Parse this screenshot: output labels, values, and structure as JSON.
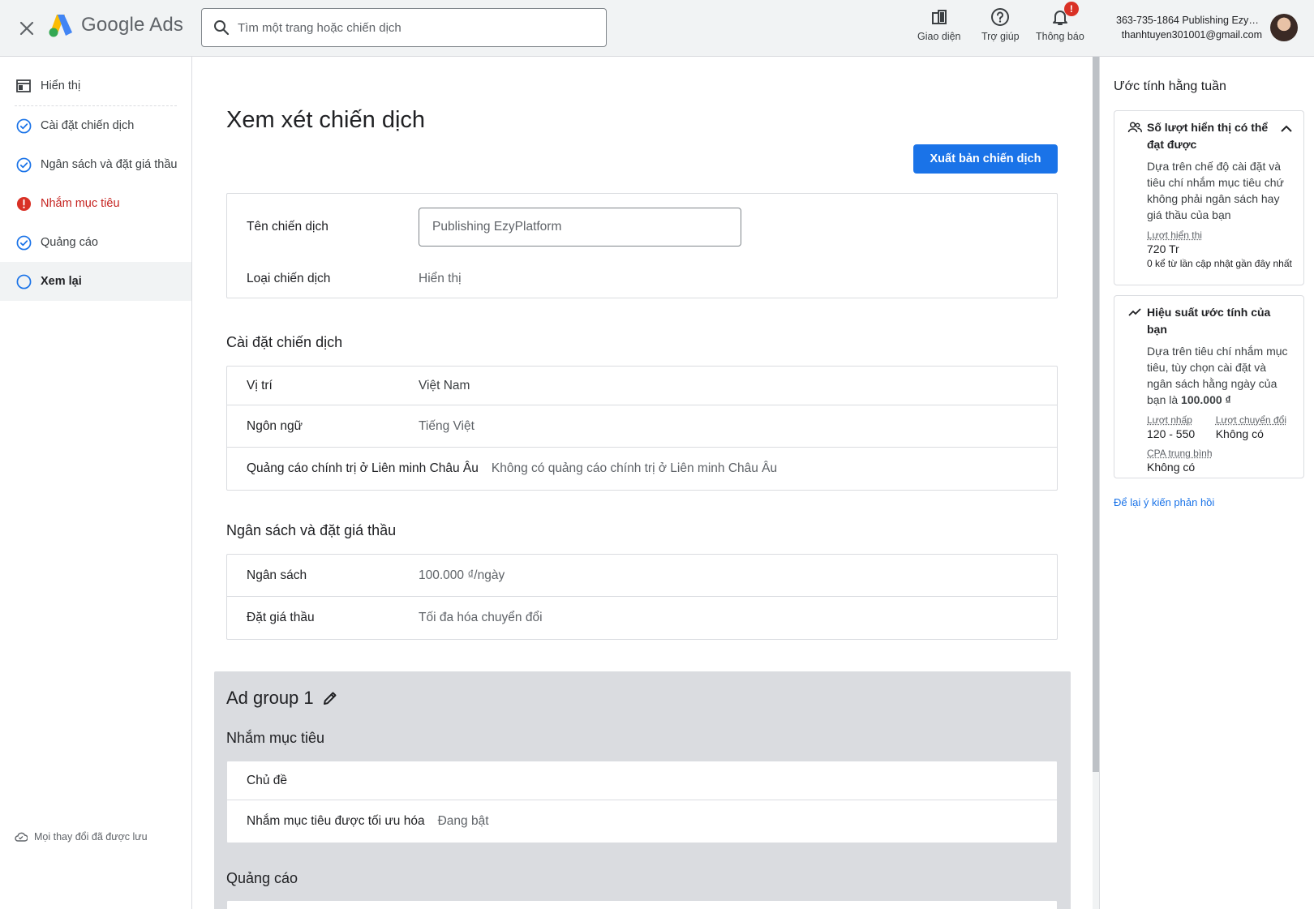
{
  "header": {
    "logo_text": "Google Ads",
    "search_placeholder": "Tìm một trang hoặc chiến dịch",
    "appearance_label": "Giao diện",
    "help_label": "Trợ giúp",
    "notifications_label": "Thông báo",
    "notifications_badge": "!",
    "account_name": "363-735-1864 Publishing EzyP...",
    "account_email": "thanhtuyen301001@gmail.com"
  },
  "sidebar": {
    "display_label": "Hiển thị",
    "items": [
      {
        "label": "Cài đặt chiến dịch",
        "status": "done"
      },
      {
        "label": "Ngân sách và đặt giá thầu",
        "status": "done"
      },
      {
        "label": "Nhắm mục tiêu",
        "status": "error"
      },
      {
        "label": "Quảng cáo",
        "status": "done"
      },
      {
        "label": "Xem lại",
        "status": "current"
      }
    ],
    "saved_text": "Mọi thay đổi đã được lưu"
  },
  "main": {
    "title": "Xem xét chiến dịch",
    "publish_button": "Xuất bản chiến dịch",
    "campaign": {
      "name_label": "Tên chiến dịch",
      "name_value": "Publishing EzyPlatform",
      "type_label": "Loại chiến dịch",
      "type_value": "Hiển thị"
    },
    "settings": {
      "title": "Cài đặt chiến dịch",
      "location_label": "Vị trí",
      "location_value": "Việt Nam",
      "language_label": "Ngôn ngữ",
      "language_value": "Tiếng Việt",
      "eu_label": "Quảng cáo chính trị ở Liên minh Châu Âu",
      "eu_value": "Không có quảng cáo chính trị ở Liên minh Châu Âu"
    },
    "budget": {
      "title": "Ngân sách và đặt giá thầu",
      "budget_label": "Ngân sách",
      "budget_value": "100.000 ₫/ngày",
      "bidding_label": "Đặt giá thầu",
      "bidding_value": "Tối đa hóa chuyển đổi"
    },
    "adgroup": {
      "title": "Ad group 1",
      "targeting_title": "Nhắm mục tiêu",
      "topics_label": "Chủ đề",
      "optimized_label": "Nhắm mục tiêu được tối ưu hóa",
      "optimized_value": "Đang bật",
      "ads_title": "Quảng cáo"
    }
  },
  "right_panel": {
    "title": "Ước tính hằng tuần",
    "reach": {
      "title": "Số lượt hiển thị có thể đạt được",
      "desc": "Dựa trên chế độ cài đặt và tiêu chí nhắm mục tiêu chứ không phải ngân sách hay giá thầu của bạn",
      "impressions_label": "Lượt hiển thị",
      "impressions_value": "720 Tr",
      "note": "0 kể từ lần cập nhật gần đây nhất"
    },
    "performance": {
      "title": "Hiệu suất ước tính của bạn",
      "desc": "Dựa trên tiêu chí nhắm mục tiêu, tùy chọn cài đặt và ngân sách hằng ngày của bạn là",
      "desc_amount": "100.000 ₫",
      "clicks_label": "Lượt nhấp",
      "clicks_value": "120 - 550",
      "conversions_label": "Lượt chuyển đổi",
      "conversions_value": "Không có",
      "cpa_label": "CPA trung bình",
      "cpa_value": "Không có"
    },
    "feedback_link": "Để lại ý kiến phản hồi"
  },
  "colors": {
    "primary": "#1a73e8",
    "error": "#d93025",
    "done": "#1a73e8"
  }
}
